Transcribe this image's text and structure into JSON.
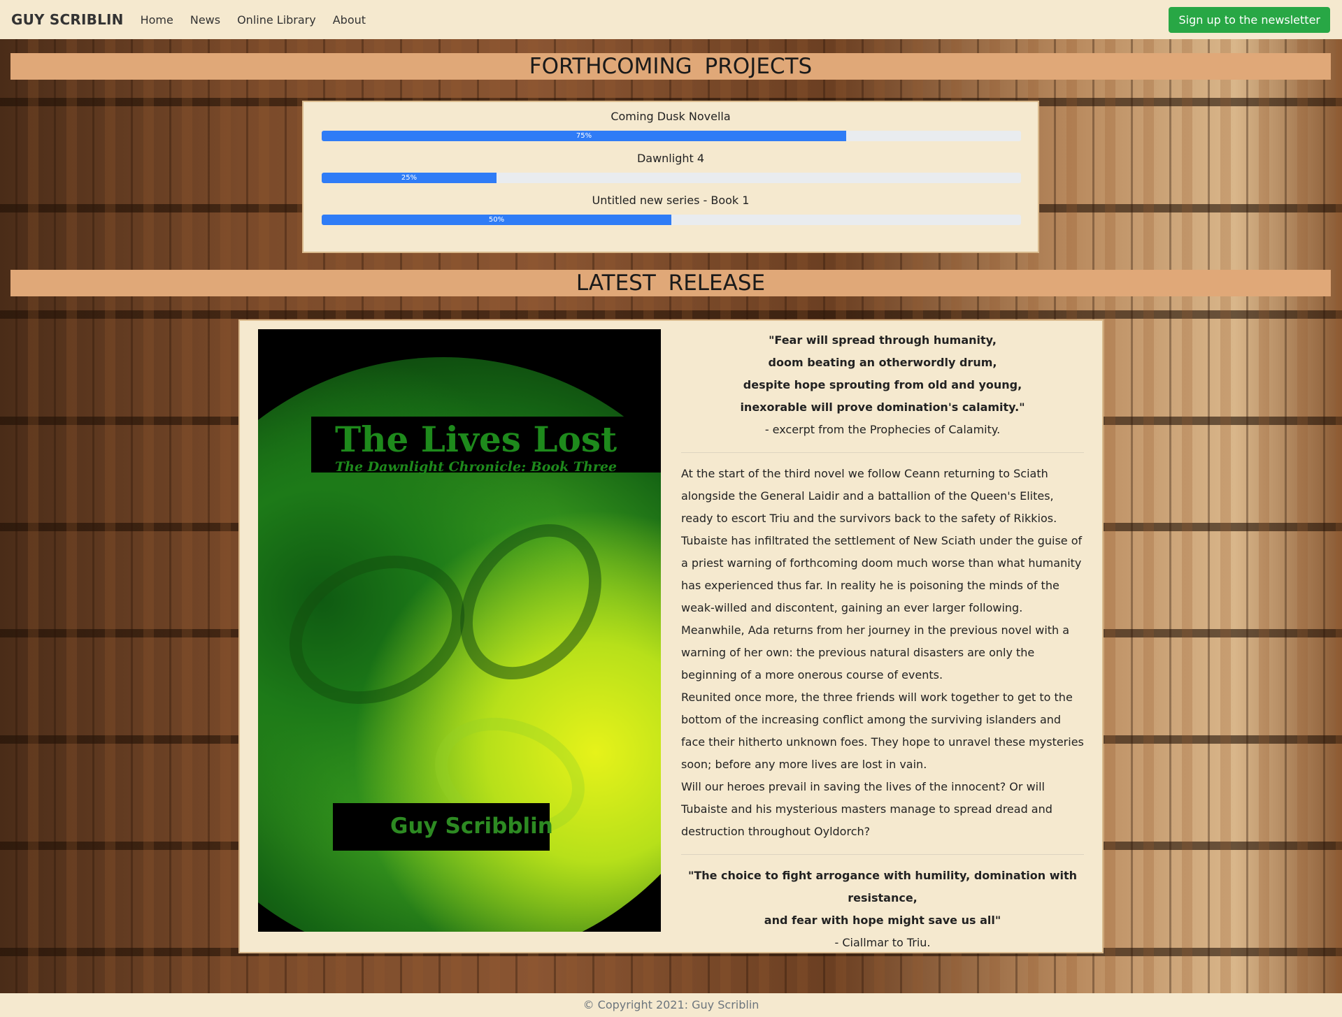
{
  "nav": {
    "brand": "GUY SCRIBLIN",
    "links": [
      "Home",
      "News",
      "Online Library",
      "About"
    ],
    "cta": "Sign up to the newsletter"
  },
  "projects": {
    "heading": "FORTHCOMING  PROJECTS",
    "items": [
      {
        "title": "Coming Dusk Novella",
        "progress": 75,
        "label": "75%"
      },
      {
        "title": "Dawnlight 4",
        "progress": 25,
        "label": "25%"
      },
      {
        "title": "Untitled new series - Book 1",
        "progress": 50,
        "label": "50%"
      }
    ]
  },
  "release": {
    "heading": "LATEST  RELEASE",
    "cover": {
      "title": "The Lives Lost",
      "subtitle": "The Dawnlight Chronicle: Book Three",
      "author": "Guy Scribblin"
    },
    "quote_top": {
      "line1": "\"Fear will spread through humanity,",
      "line2": "doom beating an otherwordly drum,",
      "line3": "despite hope sprouting from old and young,",
      "line4": "inexorable will prove domination's calamity.\"",
      "attr": "- excerpt from the Prophecies of Calamity."
    },
    "paragraphs": [
      "At the start of the third novel we follow Ceann returning to Sciath alongside the General Laidir and a battallion of the Queen's Elites, ready to escort Triu and the survivors back to the safety of Rikkios.",
      "Tubaiste has infiltrated the settlement of New Sciath under the guise of a priest warning of forthcoming doom much worse than what humanity has experienced thus far. In reality he is poisoning the minds of the weak-willed and discontent, gaining an ever larger following.",
      "Meanwhile, Ada returns from her journey in the previous novel with a warning of her own: the previous natural disasters are only the beginning of a more onerous course of events.",
      "Reunited once more, the three friends will work together to get to the bottom of the increasing conflict among the surviving islanders and face their hitherto unknown foes. They hope to unravel these mysteries soon; before any more lives are lost in vain.",
      "Will our heroes prevail in saving the lives of the innocent? Or will Tubaiste and his mysterious masters manage to spread dread and destruction throughout Oyldorch?"
    ],
    "quote_bottom": {
      "line1": "\"The choice to fight arrogance with humility, domination with resistance,",
      "line2": "and fear with hope might save us all\"",
      "attr": "- Ciallmar to Triu."
    }
  },
  "footer": {
    "copyright": "© Copyright 2021: Guy Scriblin"
  }
}
